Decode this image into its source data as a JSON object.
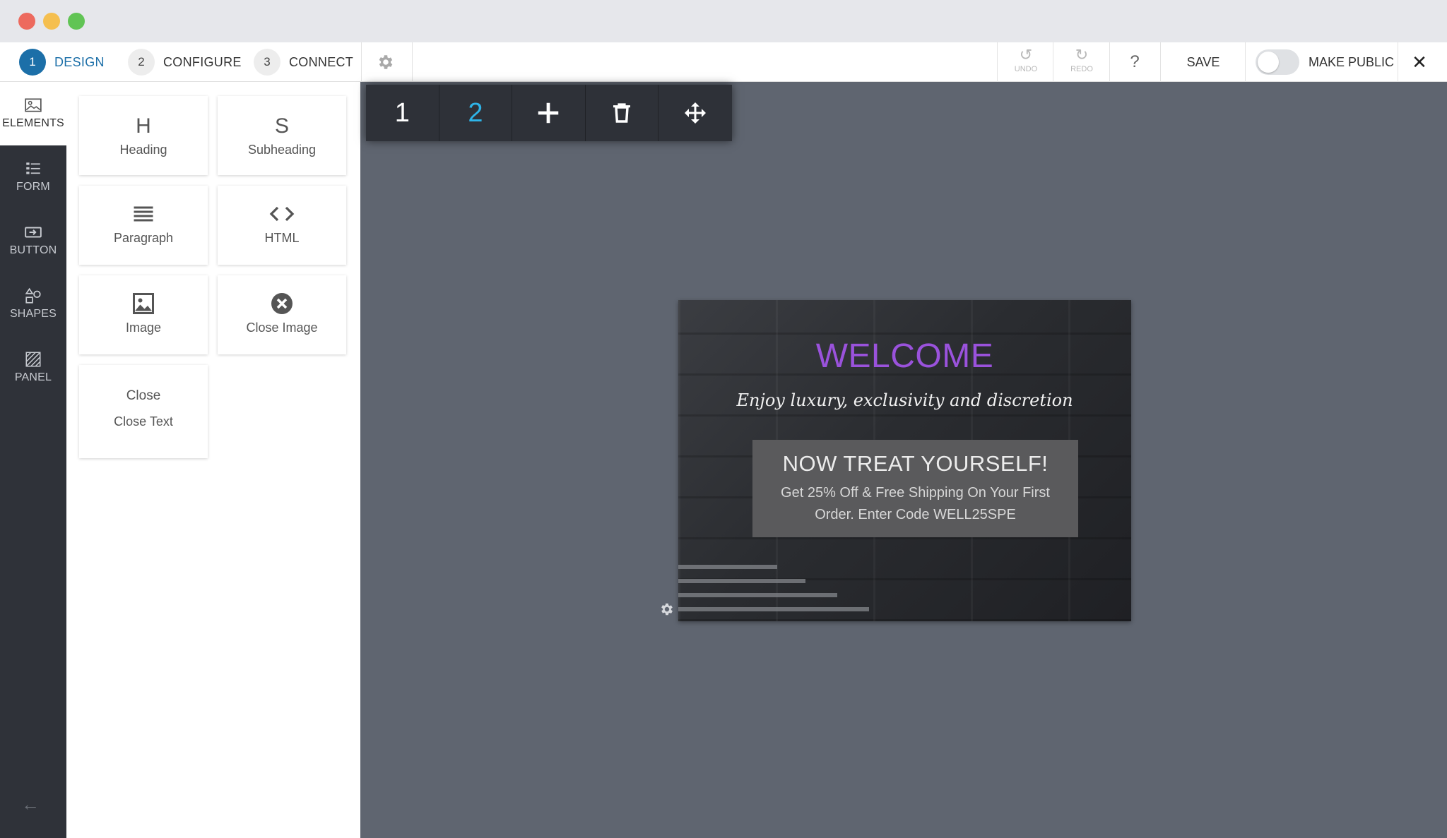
{
  "steps": [
    {
      "num": "1",
      "label": "DESIGN"
    },
    {
      "num": "2",
      "label": "CONFIGURE"
    },
    {
      "num": "3",
      "label": "CONNECT"
    }
  ],
  "toolbar": {
    "undo_label": "UNDO",
    "redo_label": "REDO",
    "help_label": "?",
    "save_label": "SAVE",
    "make_public_label": "MAKE PUBLIC",
    "make_public_on": false,
    "close_label": "✕"
  },
  "rail": [
    {
      "label": "ELEMENTS",
      "icon": "image-icon",
      "active": true
    },
    {
      "label": "FORM",
      "icon": "form-list-icon",
      "active": false
    },
    {
      "label": "BUTTON",
      "icon": "button-icon",
      "active": false
    },
    {
      "label": "SHAPES",
      "icon": "shapes-icon",
      "active": false
    },
    {
      "label": "PANEL",
      "icon": "panel-icon",
      "active": false
    }
  ],
  "rail_back": "←",
  "elements": [
    {
      "glyph": "H",
      "name": "Heading"
    },
    {
      "glyph": "S",
      "name": "Subheading"
    },
    {
      "glyph": "",
      "name": "Paragraph",
      "icon": "paragraph-icon"
    },
    {
      "glyph": "",
      "name": "HTML",
      "icon": "code-icon"
    },
    {
      "glyph": "",
      "name": "Image",
      "icon": "image-icon"
    },
    {
      "glyph": "",
      "name": "Close Image",
      "icon": "close-circle-icon"
    },
    {
      "glyph": "Close",
      "name": "Close Text"
    }
  ],
  "pagebar": {
    "pages": [
      "1",
      "2"
    ],
    "active_page": "2",
    "add_icon": "plus-icon",
    "delete_icon": "trash-icon",
    "move_icon": "move-icon"
  },
  "popup": {
    "title": "WELCOME",
    "tagline": "Enjoy luxury, exclusivity and discretion",
    "offer_heading": "NOW TREAT YOURSELF!",
    "offer_body": "Get 25% Off & Free Shipping On Your First Order. Enter Code WELL25SPE"
  },
  "colors": {
    "accent": "#1c6fa8",
    "page_active": "#2eb4e8",
    "welcome": "#9a52dc",
    "canvas": "#5f6570",
    "rail": "#2f3239"
  }
}
